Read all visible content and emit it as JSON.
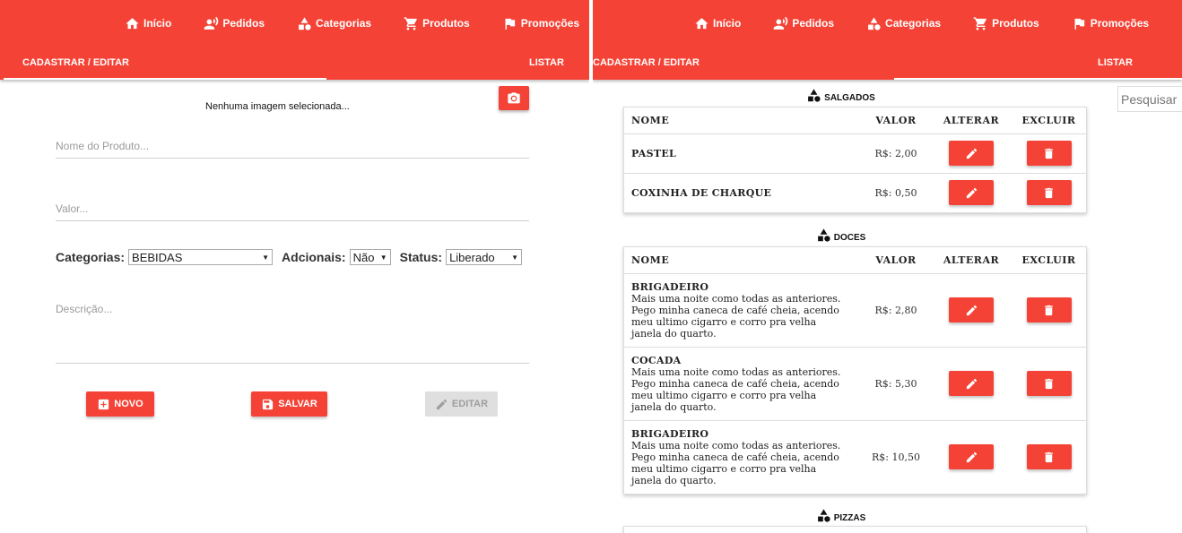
{
  "nav": {
    "items": [
      {
        "label": "Início",
        "icon": "home-icon"
      },
      {
        "label": "Pedidos",
        "icon": "person-voice-icon"
      },
      {
        "label": "Categorias",
        "icon": "shapes-icon"
      },
      {
        "label": "Produtos",
        "icon": "cart-icon"
      },
      {
        "label": "Promoções",
        "icon": "flag-icon"
      }
    ]
  },
  "tabs": {
    "register": "CADASTRAR / EDITAR",
    "list": "LISTAR"
  },
  "form": {
    "no_image_text": "Nenhuma imagem selecionada...",
    "product_name_placeholder": "Nome do Produto...",
    "value_placeholder": "Valor...",
    "categories_label": "Categorias:",
    "categories_value": "BEBIDAS",
    "additionals_label": "Adcionais:",
    "additionals_value": "Não",
    "status_label": "Status:",
    "status_value": "Liberado",
    "description_placeholder": "Descrição...",
    "new_button": "NOVO",
    "save_button": "SALVAR",
    "edit_button": "EDITAR"
  },
  "list": {
    "search_placeholder": "Pesquisar",
    "columns": {
      "name": "NOME",
      "value": "VALOR",
      "edit": "ALTERAR",
      "delete": "EXCLUIR"
    },
    "categories": [
      {
        "title": "SALGADOS",
        "products": [
          {
            "name": "PASTEL",
            "description": "",
            "value": "R$: 2,00"
          },
          {
            "name": "COXINHA DE CHARQUE",
            "description": "",
            "value": "R$: 0,50"
          }
        ]
      },
      {
        "title": "DOCES",
        "products": [
          {
            "name": "BRIGADEIRO",
            "description": "Mais uma noite como todas as anteriores. Pego minha caneca de café cheia, acendo meu ultimo cigarro e corro pra velha janela do quarto.",
            "value": "R$: 2,80"
          },
          {
            "name": "COCADA",
            "description": "Mais uma noite como todas as anteriores. Pego minha caneca de café cheia, acendo meu ultimo cigarro e corro pra velha janela do quarto.",
            "value": "R$: 5,30"
          },
          {
            "name": "BRIGADEIRO",
            "description": "Mais uma noite como todas as anteriores. Pego minha caneca de café cheia, acendo meu ultimo cigarro e corro pra velha janela do quarto.",
            "value": "R$: 10,50"
          }
        ]
      },
      {
        "title": "PIZZAS",
        "products": []
      }
    ]
  },
  "colors": {
    "accent": "#f44336",
    "disabled": "#dfdfdf"
  }
}
